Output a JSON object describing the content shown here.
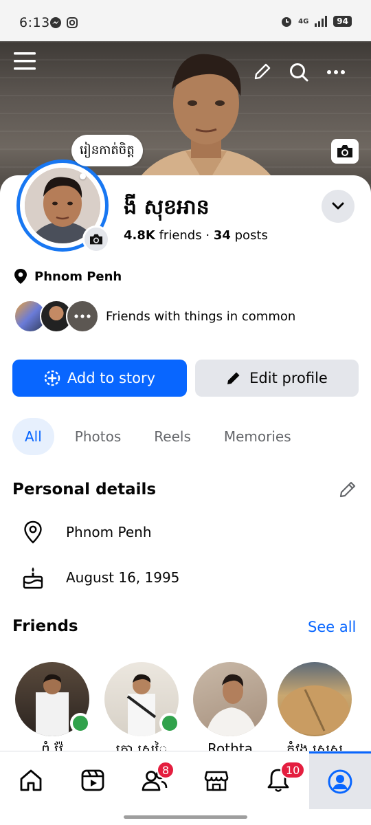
{
  "status_bar": {
    "time": "6:13",
    "network": "4G",
    "battery": "94"
  },
  "profile": {
    "note": "រៀនកាត់ចិត្ត",
    "name": "ងី សុខអាន",
    "friends_count": "4.8K",
    "friends_label": "friends",
    "separator": "·",
    "posts_count": "34",
    "posts_label": "posts",
    "location": "Phnom Penh",
    "mutual_text": "Friends with things in common"
  },
  "actions": {
    "add_story": "Add to story",
    "edit_profile": "Edit profile"
  },
  "tabs": [
    {
      "label": "All",
      "active": true
    },
    {
      "label": "Photos",
      "active": false
    },
    {
      "label": "Reels",
      "active": false
    },
    {
      "label": "Memories",
      "active": false
    }
  ],
  "personal_details": {
    "title": "Personal details",
    "location": "Phnom Penh",
    "birthday": "August 16, 1995"
  },
  "friends": {
    "title": "Friends",
    "see_all": "See all",
    "list": [
      {
        "name": "ពុំ វ៉ែ",
        "online": true
      },
      {
        "name": "គោ ស្រូៃ",
        "online": true
      },
      {
        "name": "Rothta",
        "online": false
      },
      {
        "name": "កុំវង ស្រស",
        "online": false
      }
    ]
  },
  "bottom_nav": {
    "friends_badge": "8",
    "notifications_badge": "10"
  },
  "colors": {
    "accent": "#0866ff",
    "badge": "#e41e3f",
    "online": "#31a24c"
  }
}
